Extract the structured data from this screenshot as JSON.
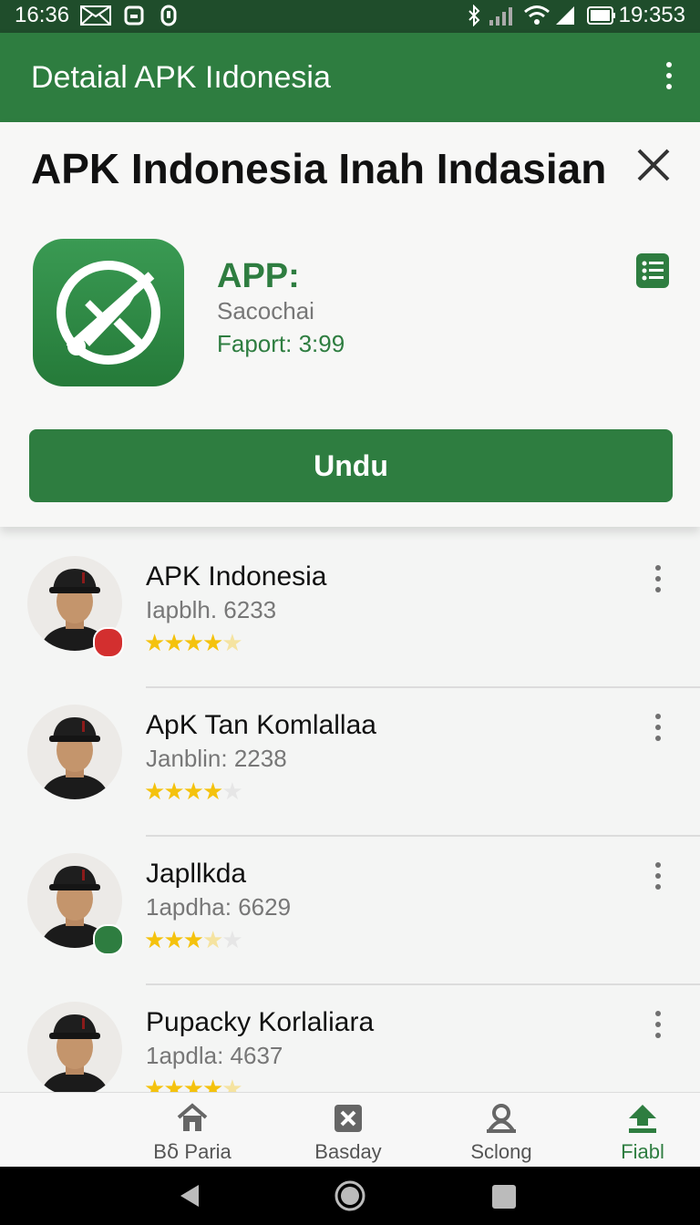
{
  "status_bar": {
    "time": "16:36",
    "clock_right": "19:353"
  },
  "app_bar": {
    "title": "Detaial APK Iıdonesia"
  },
  "detail": {
    "heading": "APK Indonesia Inah Indasian",
    "app_label": "APP:",
    "app_subtitle": "Sacochai",
    "app_price": "Faport: 3:99",
    "download_label": "Undu"
  },
  "apps": [
    {
      "name": "APK Indonesia",
      "meta": "Iapblh. 6233",
      "rating": 4.5,
      "badge_color": "#d32f2f"
    },
    {
      "name": "ApK Tan Komlallaa",
      "meta": "Janblin: 2238",
      "rating": 4,
      "badge_color": ""
    },
    {
      "name": "Japllkda",
      "meta": "1apdha: 6629",
      "rating": 3.5,
      "badge_color": "#2e7d40"
    },
    {
      "name": "Pupacky Korlaliara",
      "meta": "1apdla: 4637",
      "rating": 4.5,
      "badge_color": ""
    }
  ],
  "bottom_nav": [
    {
      "label": "Bẟ Paria",
      "icon": "home-icon",
      "active": false
    },
    {
      "label": "Basday",
      "icon": "close-box-icon",
      "active": false
    },
    {
      "label": "Sclong",
      "icon": "person-icon",
      "active": false
    },
    {
      "label": "Fiabl",
      "icon": "upload-icon",
      "active": true
    }
  ],
  "colors": {
    "primary": "#2e7d40",
    "status_bar": "#1f4d2b",
    "star": "#f4c20d"
  }
}
